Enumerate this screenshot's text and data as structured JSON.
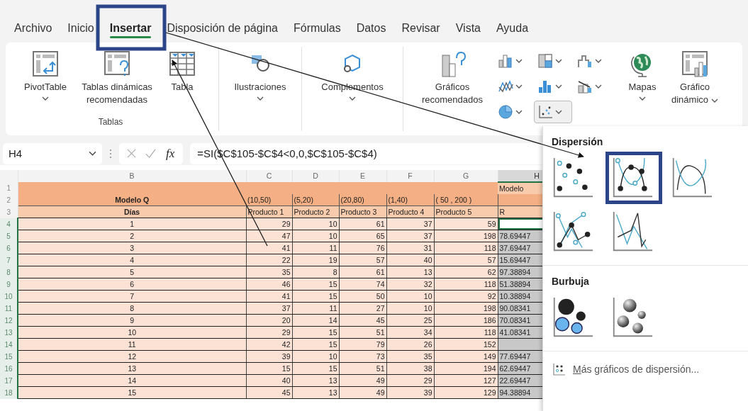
{
  "tabs": [
    {
      "label": "Archivo",
      "selected": false
    },
    {
      "label": "Inicio",
      "selected": false
    },
    {
      "label": "Insertar",
      "selected": true
    },
    {
      "label": "Disposición de página",
      "selected": false
    },
    {
      "label": "Fórmulas",
      "selected": false
    },
    {
      "label": "Datos",
      "selected": false
    },
    {
      "label": "Revisar",
      "selected": false
    },
    {
      "label": "Vista",
      "selected": false
    },
    {
      "label": "Ayuda",
      "selected": false
    }
  ],
  "ribbon": {
    "tables_group": {
      "label": "Tablas",
      "commands": [
        {
          "kind": "pivot-table",
          "label": "PivotTable",
          "dropdown": true
        },
        {
          "kind": "recommended-pivot",
          "label": "Tablas dinámicas recomendadas",
          "dropdown": false
        },
        {
          "kind": "table",
          "label": "Tabla",
          "dropdown": false
        }
      ]
    },
    "illustrations": {
      "label": "Ilustraciones",
      "dropdown": true
    },
    "addins": {
      "label": "Complementos",
      "dropdown": true
    },
    "recommended_charts": {
      "label": "Gráficos recomendados"
    },
    "chart_types": [
      {
        "kind": "column",
        "selected": false
      },
      {
        "kind": "hierarchy",
        "selected": false
      },
      {
        "kind": "waterfall",
        "selected": false
      },
      {
        "kind": "line",
        "selected": false
      },
      {
        "kind": "statistic",
        "selected": false
      },
      {
        "kind": "combo",
        "selected": false
      },
      {
        "kind": "pie",
        "selected": false
      },
      {
        "kind": "scatter",
        "selected": true
      }
    ],
    "maps": {
      "label": "Mapas",
      "dropdown": true
    },
    "pivot_chart": {
      "label": "Gráfico dinámico",
      "dropdown": true
    }
  },
  "formula_bar": {
    "name_box": "H4",
    "function_label": "fx",
    "formula": "=SI($C$105-$C$4<0,0,$C$105-$C$4)"
  },
  "sheet": {
    "column_headers": [
      {
        "label": "B",
        "selected": false
      },
      {
        "label": "C",
        "selected": false
      },
      {
        "label": "D",
        "selected": false
      },
      {
        "label": "E",
        "selected": false
      },
      {
        "label": "F",
        "selected": false
      },
      {
        "label": "G",
        "selected": false
      },
      {
        "label": "H",
        "selected": true
      }
    ],
    "rows": [
      {
        "number": "1",
        "kind": "title",
        "selected": false,
        "active_cell": false,
        "cells": [
          null,
          null,
          null,
          null,
          null,
          null,
          "Modelo"
        ]
      },
      {
        "number": "2",
        "kind": "ranges",
        "selected": false,
        "active_cell": false,
        "cells": [
          "Modelo Q",
          "(10,50)",
          "(5,20)",
          "(20,80)",
          "(1,40)",
          "( 50 , 200 )",
          null
        ]
      },
      {
        "number": "3",
        "kind": "header",
        "selected": false,
        "active_cell": false,
        "cells": [
          "Días",
          "Producto 1",
          "Producto 2",
          "Producto 3",
          "Producto 4",
          "Producto 5",
          "R"
        ]
      },
      {
        "number": "4",
        "kind": "data",
        "selected": true,
        "active_cell": true,
        "cells": [
          "1",
          "29",
          "10",
          "61",
          "37",
          "59",
          null
        ]
      },
      {
        "number": "5",
        "kind": "data",
        "selected": true,
        "active_cell": false,
        "cells": [
          "2",
          "47",
          "10",
          "65",
          "37",
          "198",
          "78.69447"
        ]
      },
      {
        "number": "6",
        "kind": "data",
        "selected": true,
        "active_cell": false,
        "cells": [
          "3",
          "41",
          "11",
          "76",
          "31",
          "118",
          "37.69447"
        ]
      },
      {
        "number": "7",
        "kind": "data",
        "selected": true,
        "active_cell": false,
        "cells": [
          "4",
          "22",
          "19",
          "57",
          "40",
          "57",
          "15.69447"
        ]
      },
      {
        "number": "8",
        "kind": "data",
        "selected": true,
        "active_cell": false,
        "cells": [
          "5",
          "35",
          "8",
          "61",
          "13",
          "62",
          "97.38894"
        ]
      },
      {
        "number": "9",
        "kind": "data",
        "selected": true,
        "active_cell": false,
        "cells": [
          "6",
          "46",
          "15",
          "74",
          "32",
          "118",
          "51.38894"
        ]
      },
      {
        "number": "10",
        "kind": "data",
        "selected": true,
        "active_cell": false,
        "cells": [
          "7",
          "41",
          "15",
          "50",
          "10",
          "92",
          "10.38894"
        ]
      },
      {
        "number": "11",
        "kind": "data",
        "selected": true,
        "active_cell": false,
        "cells": [
          "8",
          "37",
          "11",
          "27",
          "10",
          "198",
          "90.08341"
        ]
      },
      {
        "number": "12",
        "kind": "data",
        "selected": true,
        "active_cell": false,
        "cells": [
          "9",
          "20",
          "14",
          "45",
          "25",
          "186",
          "70.08341"
        ]
      },
      {
        "number": "13",
        "kind": "data",
        "selected": true,
        "active_cell": false,
        "cells": [
          "10",
          "29",
          "15",
          "51",
          "34",
          "118",
          "41.08341"
        ]
      },
      {
        "number": "14",
        "kind": "data",
        "selected": true,
        "active_cell": false,
        "cells": [
          "11",
          "42",
          "15",
          "79",
          "26",
          "152",
          null
        ]
      },
      {
        "number": "15",
        "kind": "data",
        "selected": true,
        "active_cell": false,
        "cells": [
          "12",
          "39",
          "10",
          "73",
          "35",
          "149",
          "77.69447"
        ]
      },
      {
        "number": "16",
        "kind": "data",
        "selected": true,
        "active_cell": false,
        "cells": [
          "13",
          "15",
          "15",
          "51",
          "38",
          "194",
          "62.69447"
        ]
      },
      {
        "number": "17",
        "kind": "data",
        "selected": true,
        "active_cell": false,
        "cells": [
          "14",
          "40",
          "13",
          "49",
          "29",
          "127",
          "22.69447"
        ]
      },
      {
        "number": "18",
        "kind": "data",
        "selected": true,
        "active_cell": false,
        "cells": [
          "15",
          "45",
          "13",
          "49",
          "39",
          "129",
          "94.38894"
        ]
      }
    ]
  },
  "chart_menu": {
    "sections": [
      {
        "title": "Dispersión",
        "options": [
          {
            "kind": "scatter",
            "selected": false
          },
          {
            "kind": "smooth-markers",
            "selected": true
          },
          {
            "kind": "smooth",
            "selected": false
          },
          {
            "kind": "straight-markers",
            "selected": false
          },
          {
            "kind": "straight",
            "selected": false
          }
        ]
      },
      {
        "title": "Burbuja",
        "options": [
          {
            "kind": "bubble",
            "selected": false
          },
          {
            "kind": "bubble-3d",
            "selected": false
          }
        ]
      }
    ],
    "more_link": "Más gráficos de dispersión..."
  }
}
